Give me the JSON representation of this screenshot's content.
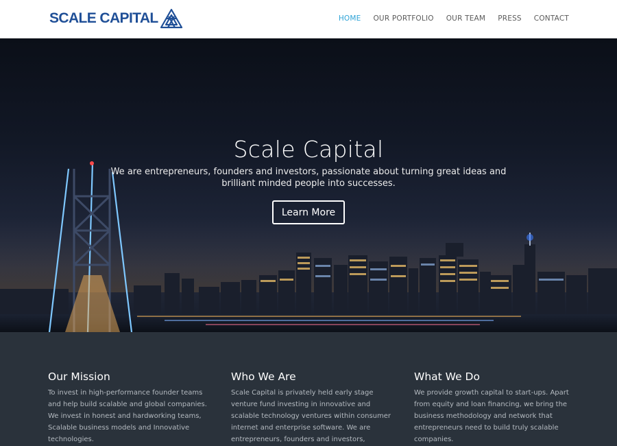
{
  "header": {
    "logo_text": "SCALE CAPITAL",
    "nav": [
      {
        "label": "HOME",
        "active": true
      },
      {
        "label": "OUR PORTFOLIO",
        "active": false
      },
      {
        "label": "OUR TEAM",
        "active": false
      },
      {
        "label": "PRESS",
        "active": false
      },
      {
        "label": "CONTACT",
        "active": false
      }
    ]
  },
  "hero": {
    "title": "Scale Capital",
    "subtitle": "We are entrepreneurs, founders and investors, passionate about turning great ideas and brilliant minded people into successes.",
    "button_label": "Learn More"
  },
  "features": [
    {
      "heading": "Our Mission",
      "text": "To invest in high-performance founder teams and help build scalable and global companies. We invest in honest and hardworking teams, Scalable business models and Innovative technologies."
    },
    {
      "heading": "Who We Are",
      "text": "Scale Capital is privately held early stage venture fund investing in innovative and scalable technology ventures within consumer internet and enterprise software. We are entrepreneurs, founders and investors, passionate about"
    },
    {
      "heading": "What We Do",
      "text": "We provide growth capital to start-ups. Apart from equity and loan financing, we bring the business methodology and network that entrepreneurs need to build truly scalable companies."
    }
  ],
  "colors": {
    "brand": "#1f4f97",
    "nav_active": "#2ea3d7",
    "features_bg": "#2a323b"
  },
  "icons": {
    "logo_mark": "triangle-logo-icon"
  }
}
